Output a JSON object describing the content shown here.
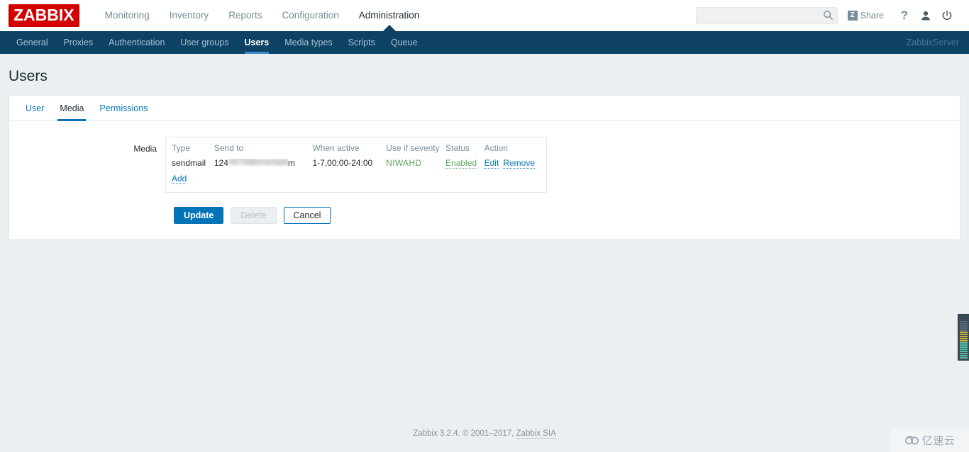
{
  "header": {
    "logo": "ZABBIX",
    "menu": [
      {
        "label": "Monitoring",
        "selected": false
      },
      {
        "label": "Inventory",
        "selected": false
      },
      {
        "label": "Reports",
        "selected": false
      },
      {
        "label": "Configuration",
        "selected": false
      },
      {
        "label": "Administration",
        "selected": true
      }
    ],
    "search": {
      "value": "",
      "placeholder": ""
    },
    "share_label": "Share",
    "share_badge": "Z",
    "help_label": "?"
  },
  "subnav": {
    "items": [
      {
        "label": "General",
        "selected": false
      },
      {
        "label": "Proxies",
        "selected": false
      },
      {
        "label": "Authentication",
        "selected": false
      },
      {
        "label": "User groups",
        "selected": false
      },
      {
        "label": "Users",
        "selected": true
      },
      {
        "label": "Media types",
        "selected": false
      },
      {
        "label": "Scripts",
        "selected": false
      },
      {
        "label": "Queue",
        "selected": false
      }
    ],
    "server_name": "ZabbixServer"
  },
  "page": {
    "title": "Users"
  },
  "form": {
    "tabs": [
      {
        "label": "User",
        "selected": false
      },
      {
        "label": "Media",
        "selected": true
      },
      {
        "label": "Permissions",
        "selected": false
      }
    ],
    "media_label": "Media",
    "table": {
      "headers": [
        "Type",
        "Send to",
        "When active",
        "Use if severity",
        "Status",
        "Action"
      ],
      "rows": [
        {
          "type": "sendmail",
          "send_to_prefix": "124",
          "send_to_redacted": "5678@example.co",
          "send_to_suffix": "m",
          "when_active": "1-7,00:00-24:00",
          "severity": "NIWAHD",
          "status": "Enabled",
          "actions": [
            "Edit",
            "Remove"
          ]
        }
      ],
      "add_label": "Add"
    },
    "buttons": {
      "update": "Update",
      "delete": "Delete",
      "cancel": "Cancel"
    }
  },
  "footer": {
    "text": "Zabbix 3.2.4. © 2001–2017, ",
    "link": "Zabbix SIA"
  },
  "watermark": {
    "text": "亿速云"
  },
  "colors": {
    "brand_red": "#d40000",
    "nav_blue": "#0e4265",
    "link_blue": "#0275b8",
    "green": "#59a659",
    "muted": "#768d99"
  }
}
